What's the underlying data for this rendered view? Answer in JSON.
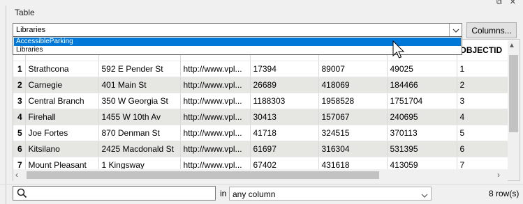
{
  "panel": {
    "title": "Table"
  },
  "table_select": {
    "value": "Libraries",
    "options": [
      "AccessibleParking",
      "Libraries"
    ],
    "highlighted": "AccessibleParking"
  },
  "columns_button": {
    "label": "Columns..."
  },
  "table": {
    "headers": [
      "",
      "",
      "",
      "",
      "",
      "",
      "",
      "OBJECTID"
    ],
    "rows": [
      [
        "1",
        "Strathcona",
        "592 E Pender St",
        "http://www.vpl...",
        "17394",
        "89007",
        "49025",
        "1"
      ],
      [
        "2",
        "Carnegie",
        "401 Main St",
        "http://www.vpl...",
        "26689",
        "418069",
        "184466",
        "2"
      ],
      [
        "3",
        "Central Branch",
        "350 W Georgia St",
        "http://www.vpl...",
        "1188303",
        "1958528",
        "1751704",
        "3"
      ],
      [
        "4",
        "Firehall",
        "1455 W 10th Av",
        "http://www.vpl...",
        "30413",
        "157067",
        "240695",
        "4"
      ],
      [
        "5",
        "Joe Fortes",
        "870 Denman St",
        "http://www.vpl...",
        "41718",
        "324515",
        "370113",
        "5"
      ],
      [
        "6",
        "Kitsilano",
        "2425 Macdonald St",
        "http://www.vpl...",
        "61697",
        "316304",
        "531395",
        "6"
      ],
      [
        "7",
        "Mount Pleasant",
        "1 Kingsway",
        "http://www.vpl...",
        "67402",
        "431618",
        "413059",
        "7"
      ]
    ]
  },
  "filter": {
    "search_value": "",
    "in_label": "in",
    "column_value": "any column"
  },
  "status": {
    "row_count": "8 row(s)"
  }
}
